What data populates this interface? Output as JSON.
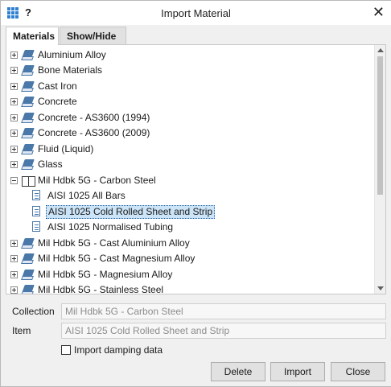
{
  "window": {
    "title": "Import Material",
    "help_label": "?",
    "close_glyph": "✕"
  },
  "tabs": [
    {
      "label": "Materials",
      "active": true
    },
    {
      "label": "Show/Hide",
      "active": false
    }
  ],
  "tree": {
    "items": [
      {
        "label": "Aluminium Alloy"
      },
      {
        "label": "Bone Materials"
      },
      {
        "label": "Cast Iron"
      },
      {
        "label": "Concrete"
      },
      {
        "label": "Concrete - AS3600 (1994)"
      },
      {
        "label": "Concrete - AS3600 (2009)"
      },
      {
        "label": "Fluid (Liquid)"
      },
      {
        "label": "Glass"
      },
      {
        "label": "Mil Hdbk 5G - Carbon Steel"
      },
      {
        "label": "AISI 1025 All Bars"
      },
      {
        "label": "AISI 1025 Cold Rolled Sheet and Strip"
      },
      {
        "label": "AISI 1025 Normalised Tubing"
      },
      {
        "label": "Mil Hdbk 5G - Cast Aluminium Alloy"
      },
      {
        "label": "Mil Hdbk 5G - Cast Magnesium Alloy"
      },
      {
        "label": "Mil Hdbk 5G - Magnesium Alloy"
      },
      {
        "label": "Mil Hdbk 5G - Stainless Steel"
      }
    ]
  },
  "form": {
    "collection_label": "Collection",
    "collection_value": "Mil Hdbk 5G - Carbon Steel",
    "item_label": "Item",
    "item_value": "AISI 1025 Cold Rolled Sheet and Strip",
    "damping_label": "Import damping data",
    "damping_checked": false
  },
  "buttons": {
    "delete": "Delete",
    "import": "Import",
    "close": "Close"
  },
  "colors": {
    "accent": "#2f7fd0",
    "selection": "#cce4f7"
  }
}
